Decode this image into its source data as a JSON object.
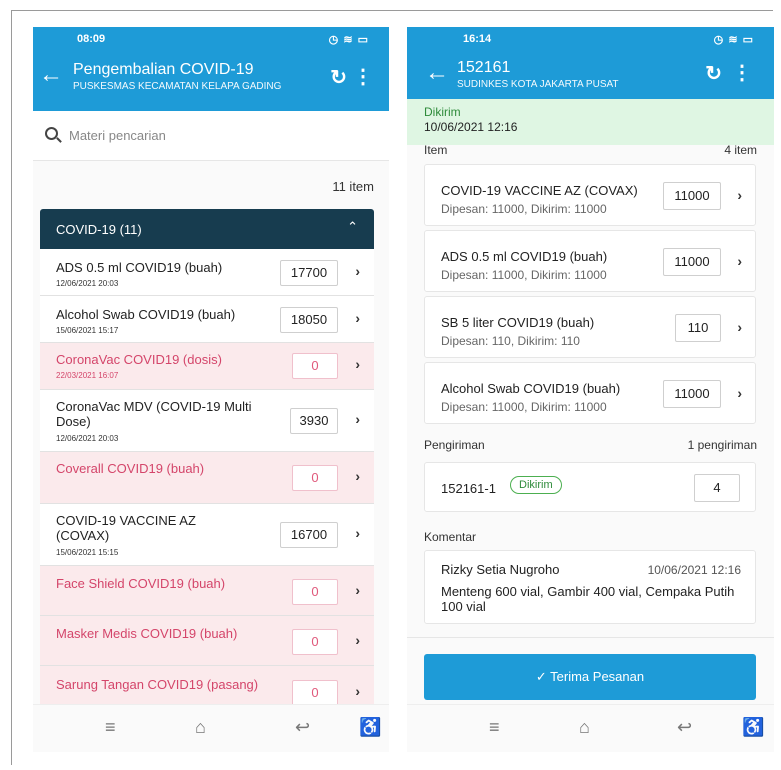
{
  "left": {
    "status_time": "08:09",
    "status_icons": "◷ ≋ ▭",
    "title": "Pengembalian COVID-19",
    "subtitle": "PUSKESMAS KECAMATAN KELAPA GADING",
    "search_placeholder": "Materi pencarian",
    "item_count": "11 item",
    "group_label": "COVID-19 (11)",
    "rows": [
      {
        "name": "ADS 0.5 ml COVID19 (buah)",
        "date": "12/06/2021 20:03",
        "qty": "17700"
      },
      {
        "name": "Alcohol Swab COVID19 (buah)",
        "date": "15/06/2021 15:17",
        "qty": "18050"
      },
      {
        "name": "CoronaVac COVID19 (dosis)",
        "date": "22/03/2021 16:07",
        "qty": "0"
      },
      {
        "name": "CoronaVac MDV (COVID-19 Multi Dose)",
        "date": "12/06/2021 20:03",
        "qty": "3930"
      },
      {
        "name": "Coverall COVID19 (buah)",
        "date": "",
        "qty": "0"
      },
      {
        "name": "COVID-19 VACCINE AZ (COVAX)",
        "date": "15/06/2021 15:15",
        "qty": "16700"
      },
      {
        "name": "Face Shield COVID19 (buah)",
        "date": "",
        "qty": "0"
      },
      {
        "name": "Masker Medis COVID19 (buah)",
        "date": "",
        "qty": "0"
      },
      {
        "name": "Sarung Tangan COVID19 (pasang)",
        "date": "",
        "qty": "0"
      }
    ]
  },
  "right": {
    "status_time": "16:14",
    "status_icons": "◷ ≋ ▭",
    "title": "152161",
    "subtitle": "SUDINKES KOTA JAKARTA PUSAT",
    "order_status": "Dikirim",
    "order_date": "10/06/2021 12:16",
    "items_label": "Item",
    "items_count": "4 item",
    "items": [
      {
        "name": "COVID-19 VACCINE AZ (COVAX)",
        "detail": "Dipesan: 11000, Dikirim: 11000",
        "qty": "11000"
      },
      {
        "name": "ADS 0.5 ml COVID19 (buah)",
        "detail": "Dipesan: 11000, Dikirim: 11000",
        "qty": "11000"
      },
      {
        "name": "SB 5 liter COVID19 (buah)",
        "detail": "Dipesan: 110, Dikirim: 110",
        "qty": "110"
      },
      {
        "name": "Alcohol Swab COVID19 (buah)",
        "detail": "Dipesan: 11000, Dikirim: 11000",
        "qty": "11000"
      }
    ],
    "shipments_label": "Pengiriman",
    "shipments_count": "1 pengiriman",
    "shipment": {
      "id": "152161-1",
      "status": "Dikirim",
      "qty": "4"
    },
    "comments_label": "Komentar",
    "comment": {
      "author": "Rizky Setia Nugroho",
      "date": "10/06/2021 12:16",
      "text": "Menteng 600 vial, Gambir 400 vial, Cempaka Putih 100 vial"
    },
    "accept_button": "✓  Terima Pesanan"
  },
  "colors": {
    "primary": "#1e9bd7",
    "group_header": "#173c4f",
    "zero_row": "#fbeaec",
    "zero_text": "#d4456a",
    "success": "#2e8b3a"
  },
  "icons": [
    "back-arrow-icon",
    "refresh-icon",
    "more-vert-icon",
    "search-icon",
    "chevron-right-icon",
    "chevron-up-icon",
    "menu-icon",
    "home-icon",
    "back-icon",
    "accessibility-icon"
  ]
}
